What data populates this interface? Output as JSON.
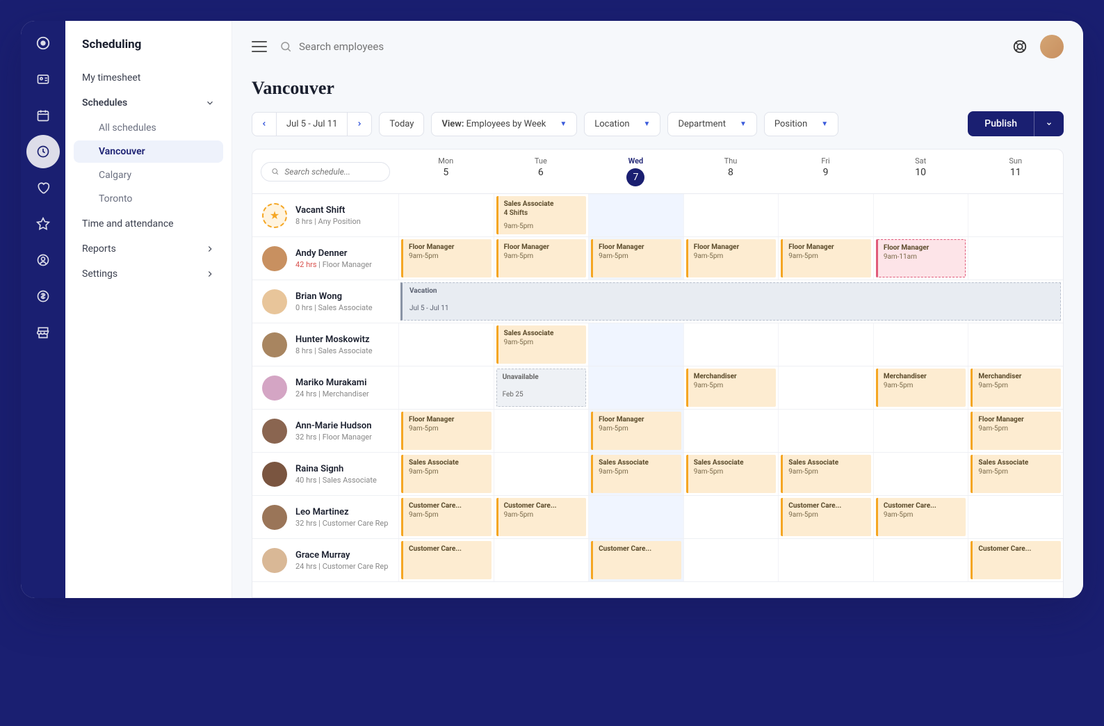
{
  "sidebar": {
    "title": "Scheduling",
    "items": [
      {
        "label": "My timesheet"
      },
      {
        "label": "Schedules",
        "expandable": true,
        "expanded": true,
        "children": [
          {
            "label": "All schedules"
          },
          {
            "label": "Vancouver",
            "selected": true
          },
          {
            "label": "Calgary"
          },
          {
            "label": "Toronto"
          }
        ]
      },
      {
        "label": "Time and attendance"
      },
      {
        "label": "Reports",
        "expandable": true
      },
      {
        "label": "Settings",
        "expandable": true
      }
    ]
  },
  "topbar": {
    "search_placeholder": "Search employees"
  },
  "page": {
    "title": "Vancouver"
  },
  "toolbar": {
    "date_range": "Jul 5 - Jul 11",
    "today": "Today",
    "view_prefix": "View:",
    "view_value": "Employees by Week",
    "filter_location": "Location",
    "filter_department": "Department",
    "filter_position": "Position",
    "publish": "Publish"
  },
  "schedule": {
    "search_placeholder": "Search schedule...",
    "days": [
      {
        "dow": "Mon",
        "num": "5"
      },
      {
        "dow": "Tue",
        "num": "6"
      },
      {
        "dow": "Wed",
        "num": "7",
        "today": true
      },
      {
        "dow": "Thu",
        "num": "8"
      },
      {
        "dow": "Fri",
        "num": "9"
      },
      {
        "dow": "Sat",
        "num": "10"
      },
      {
        "dow": "Sun",
        "num": "11"
      }
    ],
    "rows": [
      {
        "type": "vacant",
        "name": "Vacant Shift",
        "meta": "8 hrs | Any Position",
        "cells": [
          null,
          {
            "role": "Sales Associate",
            "extra": "4 Shifts",
            "time": "9am-5pm"
          },
          null,
          null,
          null,
          null,
          null
        ]
      },
      {
        "name": "Andy Denner",
        "hours": "42 hrs",
        "warn": true,
        "role": "Floor Manager",
        "av": "#c89060",
        "cells": [
          {
            "role": "Floor Manager",
            "time": "9am-5pm"
          },
          {
            "role": "Floor Manager",
            "time": "9am-5pm"
          },
          {
            "role": "Floor Manager",
            "time": "9am-5pm"
          },
          {
            "role": "Floor Manager",
            "time": "9am-5pm"
          },
          {
            "role": "Floor Manager",
            "time": "9am-5pm"
          },
          {
            "role": "Floor Manager",
            "time": "9am-11am",
            "conflict": true
          },
          null
        ]
      },
      {
        "name": "Brian Wong",
        "hours": "0 hrs",
        "role": "Sales Associate",
        "av": "#e8c59a",
        "vacation": {
          "label": "Vacation",
          "range": "Jul 5 - Jul 11"
        }
      },
      {
        "name": "Hunter Moskowitz",
        "hours": "8 hrs",
        "role": "Sales Associate",
        "av": "#a88560",
        "cells": [
          null,
          {
            "role": "Sales Associate",
            "time": "9am-5pm"
          },
          null,
          null,
          null,
          null,
          null
        ]
      },
      {
        "name": "Mariko Murakami",
        "hours": "24 hrs",
        "role": "Merchandiser",
        "av": "#d4a5c4",
        "cells": [
          null,
          {
            "unavailable": true,
            "label": "Unavailable",
            "sub": "Feb 25"
          },
          null,
          {
            "role": "Merchandiser",
            "time": "9am-5pm"
          },
          null,
          {
            "role": "Merchandiser",
            "time": "9am-5pm"
          },
          {
            "role": "Merchandiser",
            "time": "9am-5pm"
          }
        ]
      },
      {
        "name": "Ann-Marie Hudson",
        "hours": "32 hrs",
        "role": "Floor Manager",
        "av": "#8a6550",
        "cells": [
          {
            "role": "Floor Manager",
            "time": "9am-5pm"
          },
          null,
          {
            "role": "Floor Manager",
            "time": "9am-5pm"
          },
          null,
          null,
          null,
          {
            "role": "Floor Manager",
            "time": "9am-5pm"
          }
        ]
      },
      {
        "name": "Raina Signh",
        "hours": "40 hrs",
        "role": "Sales Associate",
        "av": "#7a5540",
        "cells": [
          {
            "role": "Sales Associate",
            "time": "9am-5pm"
          },
          null,
          {
            "role": "Sales Associate",
            "time": "9am-5pm"
          },
          {
            "role": "Sales Associate",
            "time": "9am-5pm"
          },
          {
            "role": "Sales Associate",
            "time": "9am-5pm"
          },
          null,
          {
            "role": "Sales Associate",
            "time": "9am-5pm"
          }
        ]
      },
      {
        "name": "Leo Martinez",
        "hours": "32 hrs",
        "role": "Customer Care Rep",
        "av": "#9a7558",
        "cells": [
          {
            "role": "Customer Care...",
            "time": "9am-5pm"
          },
          {
            "role": "Customer Care...",
            "time": "9am-5pm"
          },
          null,
          null,
          {
            "role": "Customer Care...",
            "time": "9am-5pm"
          },
          {
            "role": "Customer Care...",
            "time": "9am-5pm"
          },
          null
        ]
      },
      {
        "name": "Grace Murray",
        "hours": "24 hrs",
        "role": "Customer Care Rep",
        "av": "#d9b896",
        "cells": [
          {
            "role": "Customer Care...",
            "time": ""
          },
          null,
          {
            "role": "Customer Care...",
            "time": ""
          },
          null,
          null,
          null,
          {
            "role": "Customer Care...",
            "time": ""
          }
        ]
      }
    ]
  }
}
